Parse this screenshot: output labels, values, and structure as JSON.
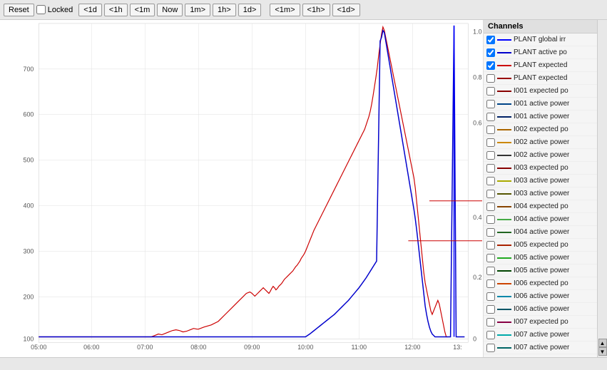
{
  "toolbar": {
    "reset_label": "Reset",
    "locked_label": "Locked",
    "locked_checked": false,
    "buttons": [
      "<1d",
      "<1h",
      "<1m",
      "Now",
      "1m>",
      "1h>",
      "1d>",
      "<1m>",
      "<1h>",
      "<1d>"
    ]
  },
  "chart": {
    "y_axis_left_labels": [
      "700",
      "600",
      "500",
      "400",
      "300",
      "200",
      "100"
    ],
    "y_axis_right_labels": [
      "1.0",
      "0.8",
      "0.6",
      "0.4",
      "0.2",
      "0"
    ],
    "x_axis_labels": [
      "05:00",
      "06:00",
      "07:00",
      "08:00",
      "09:00",
      "10:00",
      "11:00",
      "12:00",
      "13:"
    ]
  },
  "channels": {
    "header": "Channels",
    "items": [
      {
        "label": "PLANT global irr",
        "color": "#0000ff",
        "checked": true
      },
      {
        "label": "PLANT active po",
        "color": "#0000cc",
        "checked": true
      },
      {
        "label": "PLANT expected",
        "color": "#cc0000",
        "checked": true
      },
      {
        "label": "PLANT expected",
        "color": "#990000",
        "checked": false
      },
      {
        "label": "I001 expected po",
        "color": "#880000",
        "checked": false
      },
      {
        "label": "I001 active power",
        "color": "#004488",
        "checked": false
      },
      {
        "label": "I001 active power",
        "color": "#002266",
        "checked": false
      },
      {
        "label": "I002 expected po",
        "color": "#aa6600",
        "checked": false
      },
      {
        "label": "I002 active power",
        "color": "#cc8800",
        "checked": false
      },
      {
        "label": "I002 active power",
        "color": "#333333",
        "checked": false
      },
      {
        "label": "I003 expected po",
        "color": "#880000",
        "checked": false
      },
      {
        "label": "I003 active power",
        "color": "#aaaa00",
        "checked": false
      },
      {
        "label": "I003 active power",
        "color": "#555500",
        "checked": false
      },
      {
        "label": "I004 expected po",
        "color": "#884400",
        "checked": false
      },
      {
        "label": "I004 active power",
        "color": "#44aa44",
        "checked": false
      },
      {
        "label": "I004 active power",
        "color": "#226622",
        "checked": false
      },
      {
        "label": "I005 expected po",
        "color": "#aa2200",
        "checked": false
      },
      {
        "label": "I005 active power",
        "color": "#22aa22",
        "checked": false
      },
      {
        "label": "I005 active power",
        "color": "#004400",
        "checked": false
      },
      {
        "label": "I006 expected po",
        "color": "#cc4400",
        "checked": false
      },
      {
        "label": "I006 active power",
        "color": "#0088aa",
        "checked": false
      },
      {
        "label": "I006 active power",
        "color": "#005566",
        "checked": false
      },
      {
        "label": "I007 expected po",
        "color": "#880044",
        "checked": false
      },
      {
        "label": "I007 active power",
        "color": "#00aaaa",
        "checked": false
      },
      {
        "label": "I007 active power",
        "color": "#006666",
        "checked": false
      }
    ]
  },
  "bottom": {
    "text": ""
  }
}
